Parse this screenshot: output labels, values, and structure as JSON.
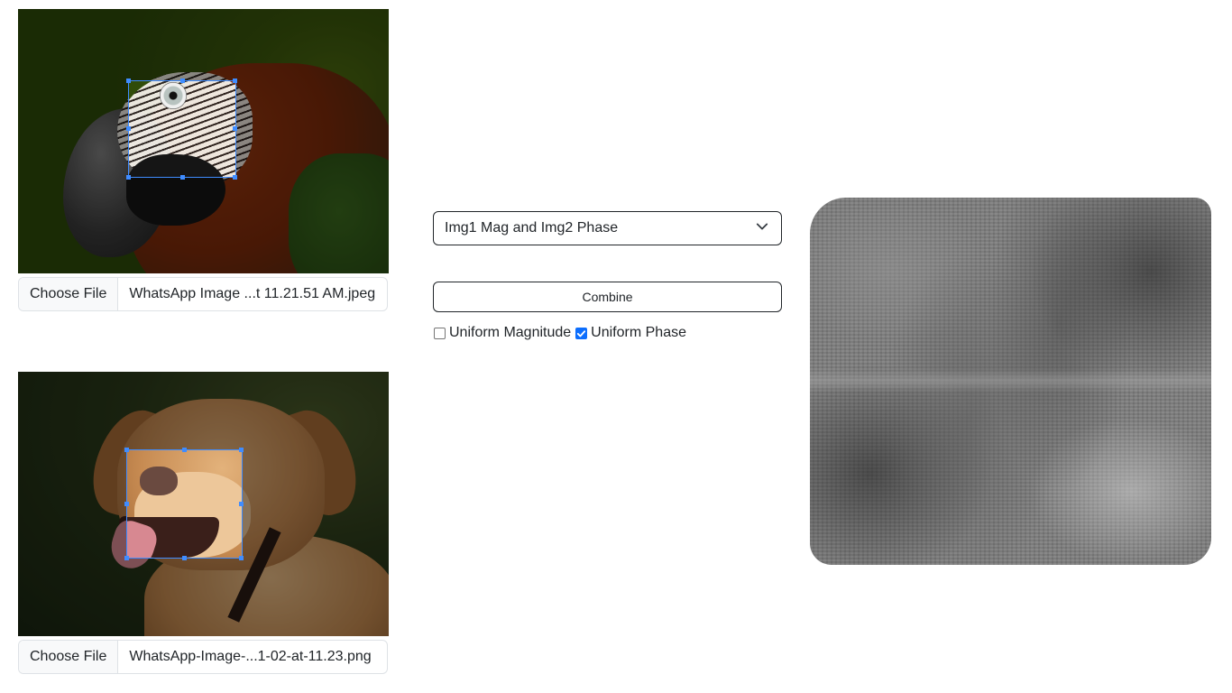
{
  "image1": {
    "file_button_label": "Choose File",
    "file_name": "WhatsApp Image ...t 11.21.51 AM.jpeg"
  },
  "image2": {
    "file_button_label": "Choose File",
    "file_name": "WhatsApp-Image-...1-02-at-11.23.png"
  },
  "controls": {
    "mode_select_value": "Img1 Mag and Img2 Phase",
    "combine_label": "Combine",
    "uniform_magnitude_label": "Uniform Magnitude",
    "uniform_magnitude_checked": false,
    "uniform_phase_label": "Uniform Phase",
    "uniform_phase_checked": true
  },
  "colors": {
    "accent": "#0d6efd",
    "crop_border": "#3f8cff"
  },
  "icons": [
    "chevron-down-icon",
    "checkmark-icon"
  ]
}
